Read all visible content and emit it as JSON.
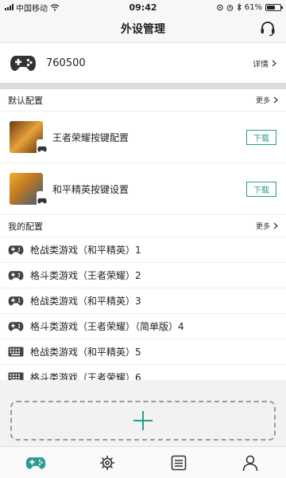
{
  "status_bar": {
    "carrier": "中国移动",
    "time": "09:42",
    "battery": "61%",
    "battery_level": 0.61
  },
  "nav": {
    "title": "外设管理",
    "support_icon": "headset-icon"
  },
  "device": {
    "name": "760500",
    "detail_label": "详情",
    "icon": "gamepad-icon"
  },
  "default_section": {
    "title": "默认配置",
    "more_label": "更多",
    "items": [
      {
        "title": "王者荣耀按键配置",
        "button": "下载"
      },
      {
        "title": "和平精英按键设置",
        "button": "下载"
      }
    ]
  },
  "my_section": {
    "title": "我的配置",
    "more_label": "更多",
    "items": [
      {
        "label": "枪战类游戏（和平精英）1",
        "icon": "gamepad-icon"
      },
      {
        "label": "格斗类游戏（王者荣耀）2",
        "icon": "gamepad-icon"
      },
      {
        "label": "枪战类游戏（和平精英）3",
        "icon": "gamepad-icon"
      },
      {
        "label": "格斗类游戏（王者荣耀）（简单版）4",
        "icon": "gamepad-icon"
      },
      {
        "label": "枪战类游戏（和平精英）5",
        "icon": "keyboard-icon"
      },
      {
        "label": "格斗类游戏（王者荣耀）6",
        "icon": "keyboard-icon"
      }
    ]
  },
  "tabs": [
    {
      "name": "controller",
      "icon": "gamepad-icon",
      "active": true
    },
    {
      "name": "settings",
      "icon": "gear-icon",
      "active": false
    },
    {
      "name": "list",
      "icon": "list-icon",
      "active": false
    },
    {
      "name": "profile",
      "icon": "user-icon",
      "active": false
    }
  ],
  "colors": {
    "accent": "#2a9d8f",
    "text": "#222222",
    "background": "#f2f2f2"
  }
}
